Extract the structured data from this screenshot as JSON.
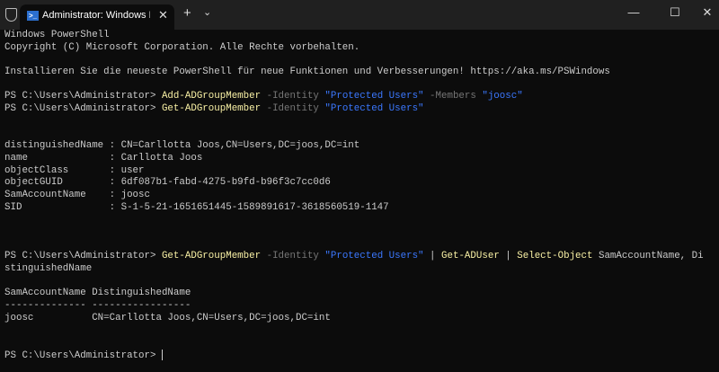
{
  "window": {
    "tab_title": "Administrator: Windows Powe",
    "new_tab": "+",
    "dropdown": "⌄",
    "minimize": "—",
    "maximize": "☐",
    "close": "✕",
    "tab_close": "✕"
  },
  "terminal": {
    "banner1": "Windows PowerShell",
    "banner2": "Copyright (C) Microsoft Corporation. Alle Rechte vorbehalten.",
    "banner3": "Installieren Sie die neueste PowerShell für neue Funktionen und Verbesserungen! https://aka.ms/PSWindows",
    "prompt": "PS C:\\Users\\Administrator> ",
    "cmd1": {
      "cmdlet": "Add-ADGroupMember",
      "p1": " -Identity ",
      "v1": "\"Protected Users\"",
      "p2": " -Members ",
      "v2": "\"joosc\""
    },
    "cmd2": {
      "cmdlet": "Get-ADGroupMember",
      "p1": " -Identity ",
      "v1": "\"Protected Users\""
    },
    "output1": [
      "distinguishedName : CN=Carllotta Joos,CN=Users,DC=joos,DC=int",
      "name              : Carllotta Joos",
      "objectClass       : user",
      "objectGUID        : 6df087b1-fabd-4275-b9fd-b96f3c7cc0d6",
      "SamAccountName    : joosc",
      "SID               : S-1-5-21-1651651445-1589891617-3618560519-1147"
    ],
    "cmd3": {
      "cmdlet": "Get-ADGroupMember",
      "p1": " -Identity ",
      "v1": "\"Protected Users\"",
      "pipe1": " | ",
      "cmdlet2": "Get-ADUser",
      "pipe2": " | ",
      "cmdlet3": "Select-Object",
      "args": " SamAccountName, Di",
      "wrap": "stinguishedName"
    },
    "table": {
      "header": "SamAccountName DistinguishedName",
      "dashes": "-------------- -----------------",
      "row": "joosc          CN=Carllotta Joos,CN=Users,DC=joos,DC=int"
    }
  }
}
